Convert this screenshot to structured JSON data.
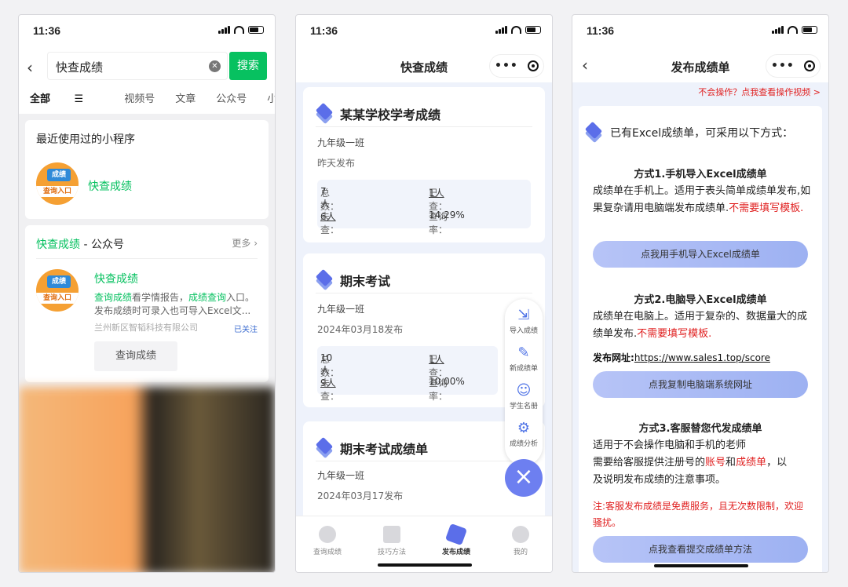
{
  "time": "11:36",
  "p1": {
    "search_value": "快查成绩",
    "search_btn": "搜索",
    "tabs": [
      "全部",
      "视频号",
      "文章",
      "公众号",
      "小程序"
    ],
    "recent_title": "最近使用过的小程序",
    "app_name": "快查成绩",
    "logo_tag": "成绩",
    "logo_text": "查询入口",
    "account_name": "快查成绩",
    "account_suffix": " - 公众号",
    "more": "更多",
    "account_title": "快查成绩",
    "desc_a": "查询成绩",
    "desc_b": "看学情报告，",
    "desc_c": "成绩查询",
    "desc_d": "入口。",
    "desc_line2": "发布成绩时可录入也可导入Excel文...",
    "org": "兰州新区智韬科技有限公司",
    "follow": "已关注",
    "service": "查询成绩"
  },
  "p2": {
    "title": "快查成绩",
    "cards": [
      {
        "title": "某某学校学考成绩",
        "class": "九年级一班",
        "date": "昨天发布",
        "total_label": "总数：",
        "total": "7人",
        "viewed_label": "已查：",
        "viewed": "1人",
        "unviewed_label": "未查：",
        "unviewed": "6人",
        "rate_label": "查询率：",
        "rate": "14.29%"
      },
      {
        "title": "期末考试",
        "class": "九年级一班",
        "date": "2024年03月18发布",
        "total_label": "总数：",
        "total": "10人",
        "viewed_label": "已查：",
        "viewed": "1人",
        "unviewed_label": "未查：",
        "unviewed": "9人",
        "rate_label": "查询率：",
        "rate": "10.00%"
      },
      {
        "title": "期末考试成绩单",
        "class": "九年级一班",
        "date": "2024年03月17发布"
      }
    ],
    "fab": [
      "导入成绩",
      "新成绩单",
      "学生名册",
      "成绩分析"
    ],
    "tabbar": [
      "查询成绩",
      "技巧方法",
      "发布成绩",
      "我的"
    ]
  },
  "p3": {
    "title": "发布成绩单",
    "help": "不会操作？点我查看操作视频 >",
    "intro": "已有Excel成绩单，可采用以下方式：",
    "m1_title": "方式1.手机导入Excel成绩单",
    "m1_text": "成绩单在手机上。适用于表头简单成绩单发布,如果复杂请用电脑端发布成绩单.",
    "m1_red": "不需要填写模板.",
    "m1_btn": "点我用手机导入Excel成绩单",
    "m2_title": "方式2.电脑导入Excel成绩单",
    "m2_text": "成绩单在电脑上。适用于复杂的、数据量大的成绩单发布.",
    "m2_red": "不需要填写模板.",
    "m2_url_label": "发布网址:",
    "m2_url": "https://www.sales1.top/score",
    "m2_btn": "点我复制电脑端系统网址",
    "m3_title": "方式3.客服替您代发成绩单",
    "m3_line1": "适用于不会操作电脑和手机的老师",
    "m3_line2a": "需要给客服提供注册号的",
    "m3_line2b": "账号",
    "m3_line2c": "和",
    "m3_line2d": "成绩单",
    "m3_line2e": "，以",
    "m3_line3": "及说明发布成绩的注意事项。",
    "m3_note": "注:客服发布成绩是免费服务，且无次数限制，欢迎骚扰。",
    "m3_btn": "点我查看提交成绩单方法"
  }
}
